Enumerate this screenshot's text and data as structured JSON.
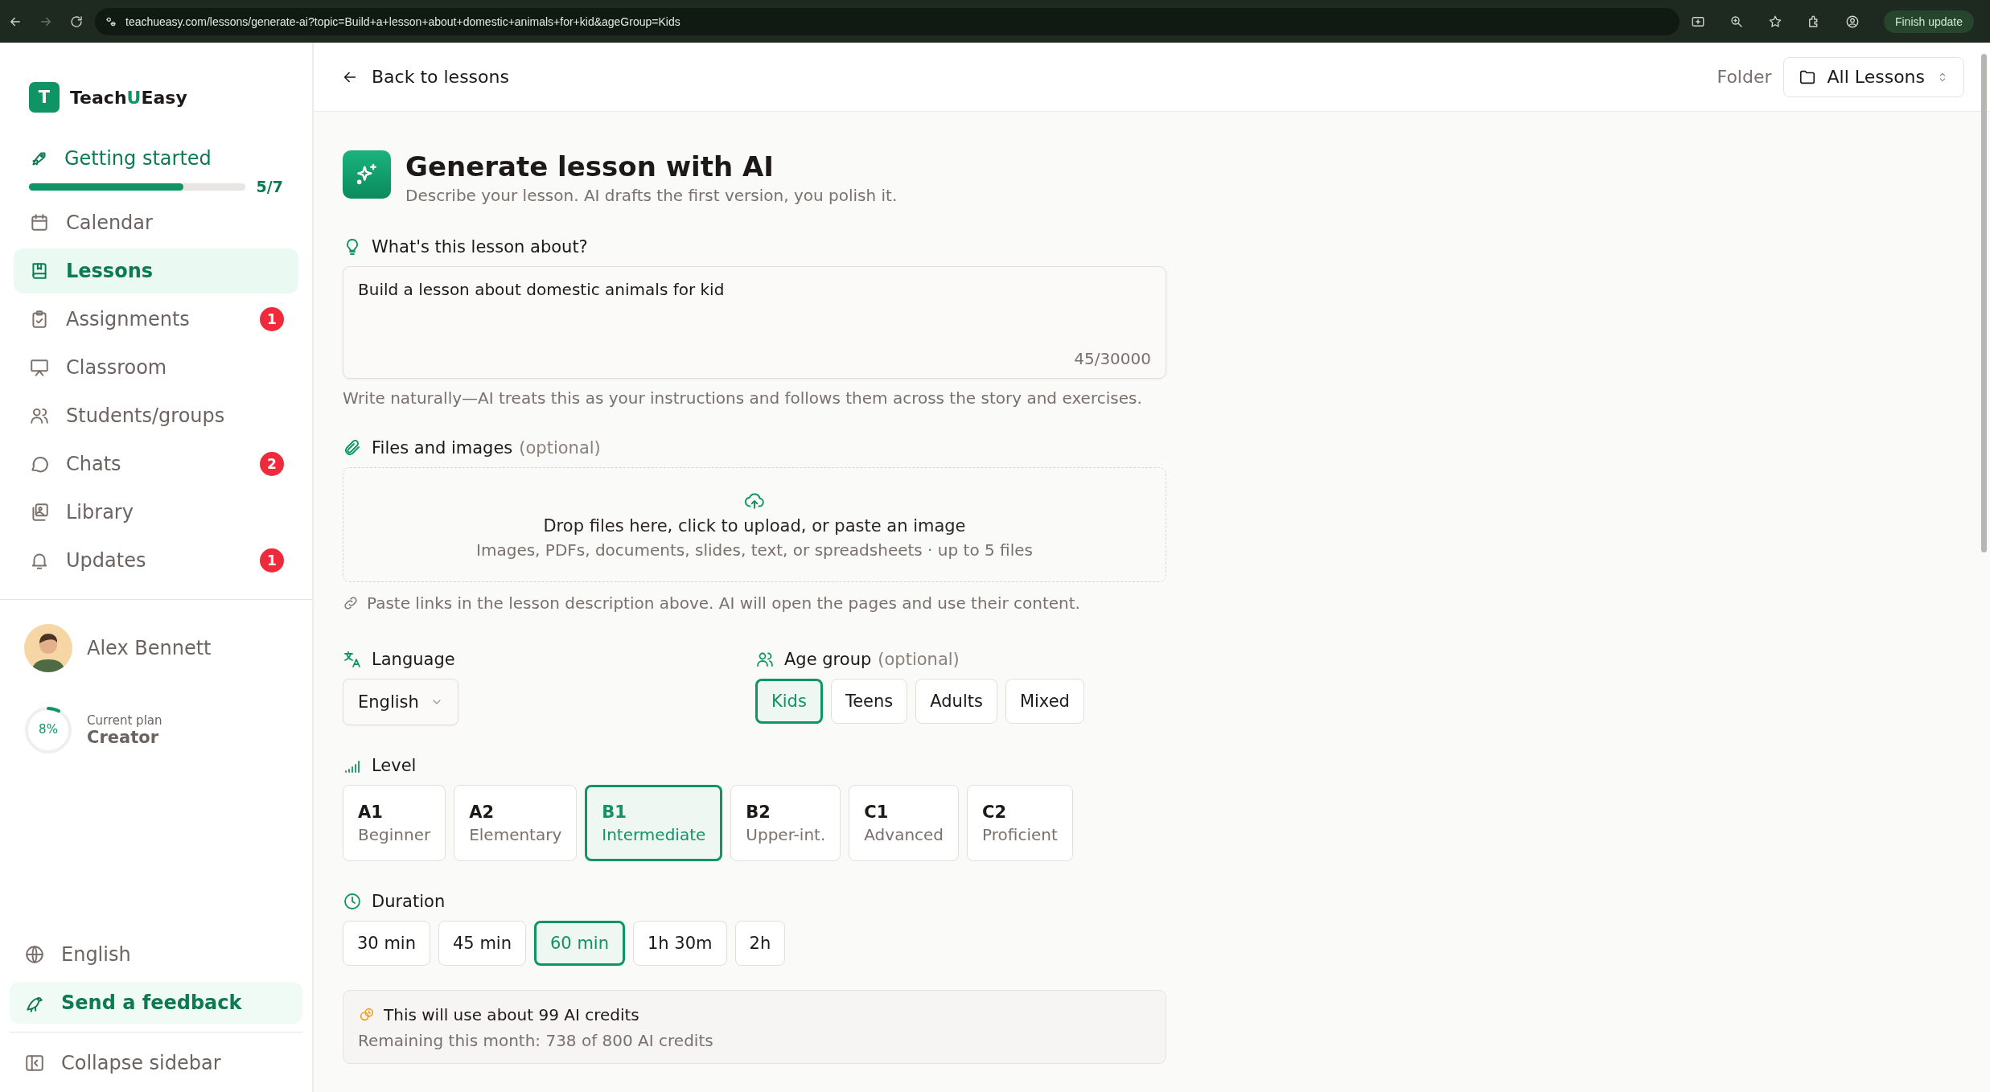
{
  "browser": {
    "url": "teachueasy.com/lessons/generate-ai?topic=Build+a+lesson+about+domestic+animals+for+kid&ageGroup=Kids",
    "update_button": "Finish update"
  },
  "sidebar": {
    "logo_letter": "T",
    "brand": [
      {
        "text": "Teach",
        "accent": false
      },
      {
        "text": "U",
        "accent": true
      },
      {
        "text": "Easy",
        "accent": false
      }
    ],
    "getting_started": {
      "label": "Getting started",
      "level": 0.714,
      "progress": "5/7"
    },
    "nav": [
      {
        "label": "Calendar",
        "selected": false
      },
      {
        "label": "Lessons",
        "selected": true
      },
      {
        "label": "Assignments",
        "selected": false,
        "badge": "1"
      },
      {
        "label": "Classroom",
        "selected": false
      },
      {
        "label": "Students/groups",
        "selected": false
      },
      {
        "label": "Chats",
        "selected": false,
        "badge": "2"
      },
      {
        "label": "Library",
        "selected": false
      },
      {
        "label": "Updates",
        "selected": false,
        "badge": "1"
      }
    ],
    "user": {
      "name": "Alex Bennett"
    },
    "plan": {
      "usage": "8%",
      "level": 0.08,
      "label": "Current plan",
      "name": "Creator"
    },
    "footer": [
      {
        "label": "English",
        "highlighted": false
      },
      {
        "label": "Send a feedback",
        "highlighted": true
      }
    ],
    "collapse": "Collapse sidebar"
  },
  "topbar": {
    "back": "Back to lessons",
    "folder_label": "Folder",
    "folder_value": "All Lessons"
  },
  "header": {
    "title": "Generate lesson with AI",
    "subtitle": "Describe your lesson. AI drafts the first version, you polish it."
  },
  "topic": {
    "label": "What's this lesson about?",
    "value": "Build a lesson about domestic animals for kid",
    "counter": "45/30000",
    "hint": "Write naturally—AI treats this as your instructions and follows them across the story and exercises."
  },
  "files": {
    "label": "Files and images",
    "optional": "(optional)",
    "drop_title": "Drop files here, click to upload, or paste an image",
    "drop_sub": "Images, PDFs, documents, slides, text, or spreadsheets · up to 5 files",
    "links_hint": "Paste links in the lesson description above. AI will open the pages and use their content."
  },
  "language": {
    "label": "Language",
    "value": "English"
  },
  "age_group": {
    "label": "Age group",
    "optional": "(optional)",
    "options": [
      {
        "label": "Kids",
        "selected": true
      },
      {
        "label": "Teens",
        "selected": false
      },
      {
        "label": "Adults",
        "selected": false
      },
      {
        "label": "Mixed",
        "selected": false
      }
    ]
  },
  "level": {
    "label": "Level",
    "options": [
      {
        "code": "A1",
        "name": "Beginner",
        "selected": false
      },
      {
        "code": "A2",
        "name": "Elementary",
        "selected": false
      },
      {
        "code": "B1",
        "name": "Intermediate",
        "selected": true
      },
      {
        "code": "B2",
        "name": "Upper-int.",
        "selected": false
      },
      {
        "code": "C1",
        "name": "Advanced",
        "selected": false
      },
      {
        "code": "C2",
        "name": "Proficient",
        "selected": false
      }
    ]
  },
  "duration": {
    "label": "Duration",
    "options": [
      {
        "label": "30 min",
        "selected": false
      },
      {
        "label": "45 min",
        "selected": false
      },
      {
        "label": "60 min",
        "selected": true
      },
      {
        "label": "1h 30m",
        "selected": false
      },
      {
        "label": "2h",
        "selected": false
      }
    ]
  },
  "credits": {
    "title": "This will use about 99 AI credits",
    "remaining": "Remaining this month: 738 of 800 AI credits"
  }
}
